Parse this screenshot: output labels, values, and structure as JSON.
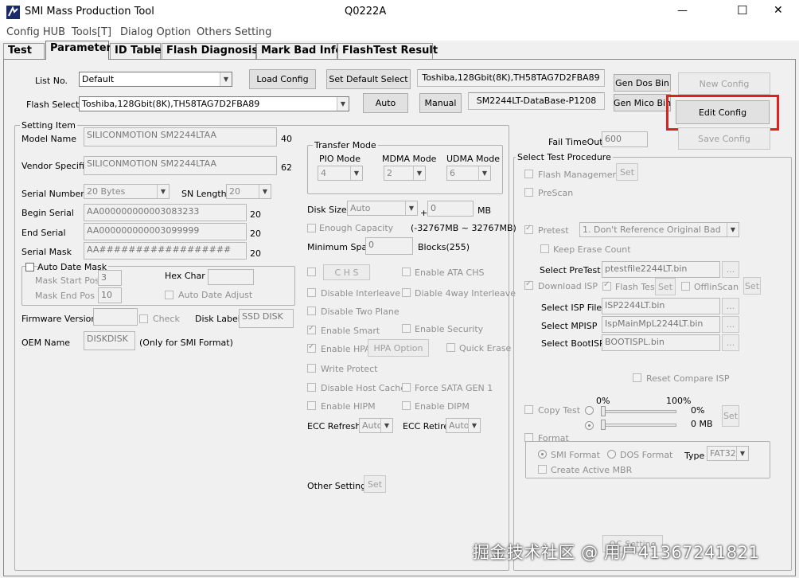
{
  "window": {
    "title": "SMI Mass Production Tool",
    "version": "Q0222A",
    "minimize": "—",
    "maximize": "☐",
    "close": "✕"
  },
  "menu": [
    "Config HUB",
    "Tools[T]",
    "Dialog Option",
    "Others Setting"
  ],
  "tabs": [
    "Test",
    "Parameter",
    "ID Table",
    "Flash Diagnosis",
    "Mark Bad Info",
    "FlashTest Result"
  ],
  "active_tab": "Parameter",
  "top": {
    "list_no_label": "List No.",
    "list_no_value": "Default",
    "load_config": "Load Config",
    "set_default_select": "Set Default Select",
    "flash_info": "Toshiba,128Gbit(8K),TH58TAG7D2FBA89",
    "gen_dos_bin": "Gen Dos Bin",
    "new_config": "New Config",
    "flash_select_label": "Flash Select",
    "flash_select_value": "Toshiba,128Gbit(8K),TH58TAG7D2FBA89",
    "auto": "Auto",
    "manual": "Manual",
    "database": "SM2244LT-DataBase-P1208",
    "gen_mico_bin": "Gen Mico Bin",
    "edit_config": "Edit Config",
    "save_config": "Save Config",
    "fail_timeout_label": "Fail TimeOut",
    "fail_timeout_value": "600"
  },
  "setting": {
    "title": "Setting Item",
    "model_name_label": "Model Name",
    "model_name": "SILICONMOTION SM2244LTAA",
    "model_len": "40",
    "vendor_label": "Vendor Specific",
    "vendor": "SILICONMOTION SM2244LTAA",
    "vendor_len": "62",
    "serial_number_label": "Serial Number",
    "serial_number": "20 Bytes",
    "sn_length_label": "SN Length",
    "sn_length": "20",
    "begin_serial_label": "Begin Serial",
    "begin_serial": "AA000000000003083233",
    "begin_len": "20",
    "end_serial_label": "End Serial",
    "end_serial": "AA000000000003099999",
    "end_len": "20",
    "serial_mask_label": "Serial Mask",
    "serial_mask": "AA##################",
    "mask_len": "20",
    "auto_date_mask": "Auto Date Mask",
    "mask_start_label": "Mask Start Pos",
    "mask_start": "3",
    "hex_char_label": "Hex Char",
    "mask_end_label": "Mask End Pos",
    "mask_end": "10",
    "auto_date_adjust": "Auto Date Adjust",
    "firmware_label": "Firmware Version",
    "check": "Check",
    "disk_label_label": "Disk Label",
    "disk_label": "SSD DISK",
    "oem_label": "OEM Name",
    "oem": "DISKDISK",
    "oem_note": "(Only for SMI Format)"
  },
  "transfer": {
    "title": "Transfer Mode",
    "pio_label": "PIO Mode",
    "pio": "4",
    "mdma_label": "MDMA Mode",
    "mdma": "2",
    "udma_label": "UDMA Mode",
    "udma": "6"
  },
  "disk": {
    "size_label": "Disk Size",
    "size": "Auto",
    "plus": "+",
    "size_extra": "0",
    "mb": "MB",
    "enough_capacity": "Enough Capacity",
    "range": "(-32767MB ~ 32767MB)",
    "min_spare_label": "Minimum Spare",
    "min_spare": "0",
    "blocks": "Blocks(255)",
    "chs": "C H S",
    "enable_ata_chs": "Enable ATA CHS",
    "disable_interleave": "Disable Interleave",
    "diable_4way": "Diable 4way Interleave",
    "disable_two_plane": "Disable Two Plane",
    "enable_smart": "Enable Smart",
    "enable_security": "Enable Security",
    "enable_hpa": "Enable HPA",
    "hpa_option": "HPA Option",
    "quick_erase": "Quick Erase",
    "write_protect": "Write Protect",
    "disable_host_cache": "Disable Host Cache",
    "force_sata_gen1": "Force SATA GEN 1",
    "enable_hipm": "Enable HIPM",
    "enable_dipm": "Enable DIPM",
    "ecc_refresh_label": "ECC Refresh",
    "ecc_refresh": "Auto",
    "ecc_retire_label": "ECC Retire",
    "ecc_retire": "Auto",
    "other_setting": "Other Setting",
    "set": "Set"
  },
  "procedure": {
    "title": "Select Test Procedure",
    "flash_management": "Flash Management",
    "set": "Set",
    "prescan": "PreScan",
    "pretest": "Pretest",
    "pretest_option": "1. Don't Reference Original Bad",
    "keep_erase_count": "Keep Erase Count",
    "select_pretest_label": "Select PreTest",
    "select_pretest": "ptestfile2244LT.bin",
    "download_isp": "Download ISP",
    "flash_test": "Flash Test",
    "offline_scan": "OfflinScan",
    "select_isp_label": "Select ISP File",
    "select_isp": "ISP2244LT.bin",
    "select_mpisp_label": "Select MPISP",
    "select_mpisp": "IspMainMpL2244LT.bin",
    "select_bootisp_label": "Select BootISP",
    "select_bootisp": "BOOTISPL.bin",
    "browse": "...",
    "reset_compare_isp": "Reset Compare ISP",
    "pct0": "0%",
    "pct100": "100%",
    "copy_test": "Copy Test",
    "copy_pct": "0%",
    "copy_mb": "0 MB",
    "format": "Format",
    "smi_format": "SMI Format",
    "dos_format": "DOS Format",
    "type_label": "Type",
    "type": "FAT32",
    "create_active_mbr": "Create Active MBR",
    "qc_setting": "QC Setting"
  },
  "watermark": "掘金技术社区 @ 用户41367241821",
  "colors": {
    "highlight": "#e02020",
    "window_bg": "#f0f0f0"
  }
}
